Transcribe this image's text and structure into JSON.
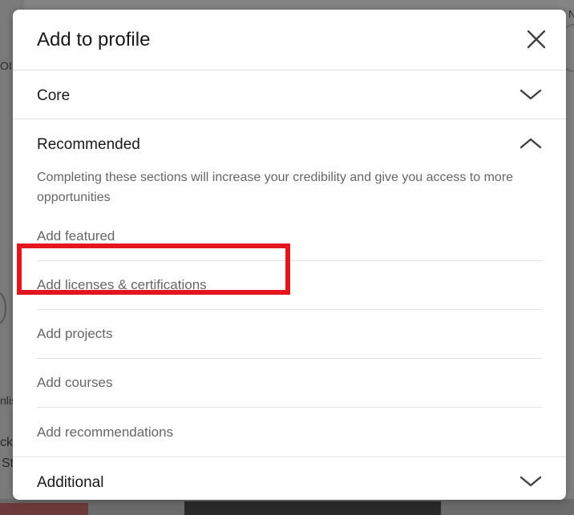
{
  "background": {
    "fragments": [
      "OID",
      "N",
      "nlis",
      "ck",
      "St"
    ]
  },
  "modal": {
    "title": "Add to profile",
    "close_icon": "close-icon",
    "sections": [
      {
        "title": "Core",
        "expanded": false
      },
      {
        "title": "Recommended",
        "expanded": true,
        "description": "Completing these sections will increase your credibility and give you access to more opportunities",
        "items": [
          "Add featured",
          "Add licenses & certifications",
          "Add projects",
          "Add courses",
          "Add recommendations"
        ]
      },
      {
        "title": "Additional",
        "expanded": false
      }
    ]
  },
  "colors": {
    "highlight": "#e3151f",
    "text_primary": "#191919",
    "text_secondary": "#666666",
    "divider": "#e0e0e0"
  }
}
